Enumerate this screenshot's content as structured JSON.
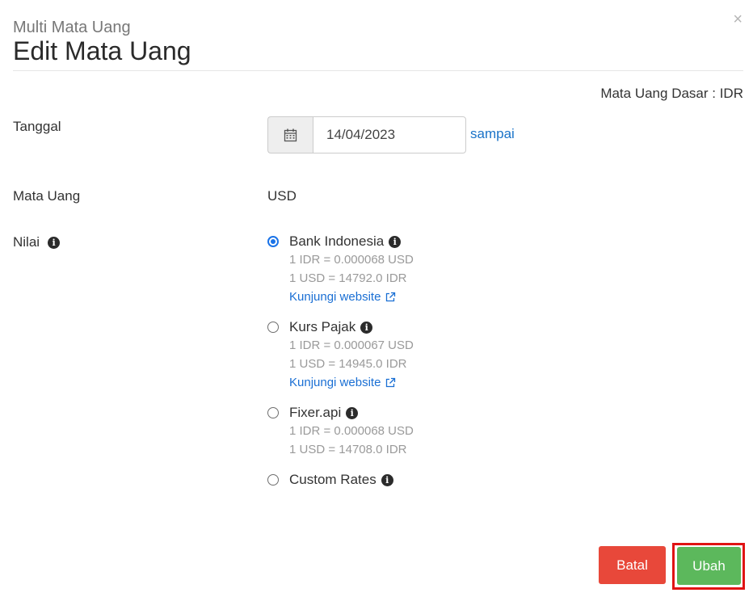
{
  "header": {
    "subtitle": "Multi Mata Uang",
    "title": "Edit Mata Uang",
    "close_label": "×"
  },
  "base_currency": "Mata Uang Dasar : IDR",
  "form": {
    "date_label": "Tanggal",
    "date_value": "14/04/2023",
    "until_link": "sampai",
    "currency_label": "Mata Uang",
    "currency_value": "USD",
    "rate_label": "Nilai"
  },
  "rate_options": [
    {
      "name": "Bank Indonesia",
      "selected": true,
      "rate_line_1": "1 IDR = 0.000068 USD",
      "rate_line_2": "1 USD = 14792.0 IDR",
      "visit_link": "Kunjungi website"
    },
    {
      "name": "Kurs Pajak",
      "selected": false,
      "rate_line_1": "1 IDR = 0.000067 USD",
      "rate_line_2": "1 USD = 14945.0 IDR",
      "visit_link": "Kunjungi website"
    },
    {
      "name": "Fixer.api",
      "selected": false,
      "rate_line_1": "1 IDR = 0.000068 USD",
      "rate_line_2": "1 USD = 14708.0 IDR"
    },
    {
      "name": "Custom Rates",
      "selected": false
    }
  ],
  "buttons": {
    "cancel": "Batal",
    "submit": "Ubah"
  },
  "colors": {
    "link": "#1a73c8",
    "radio_selected": "#1a73e8",
    "cancel_button": "#e8483a",
    "submit_button": "#5cb85c",
    "highlight_outline": "#e01414"
  }
}
